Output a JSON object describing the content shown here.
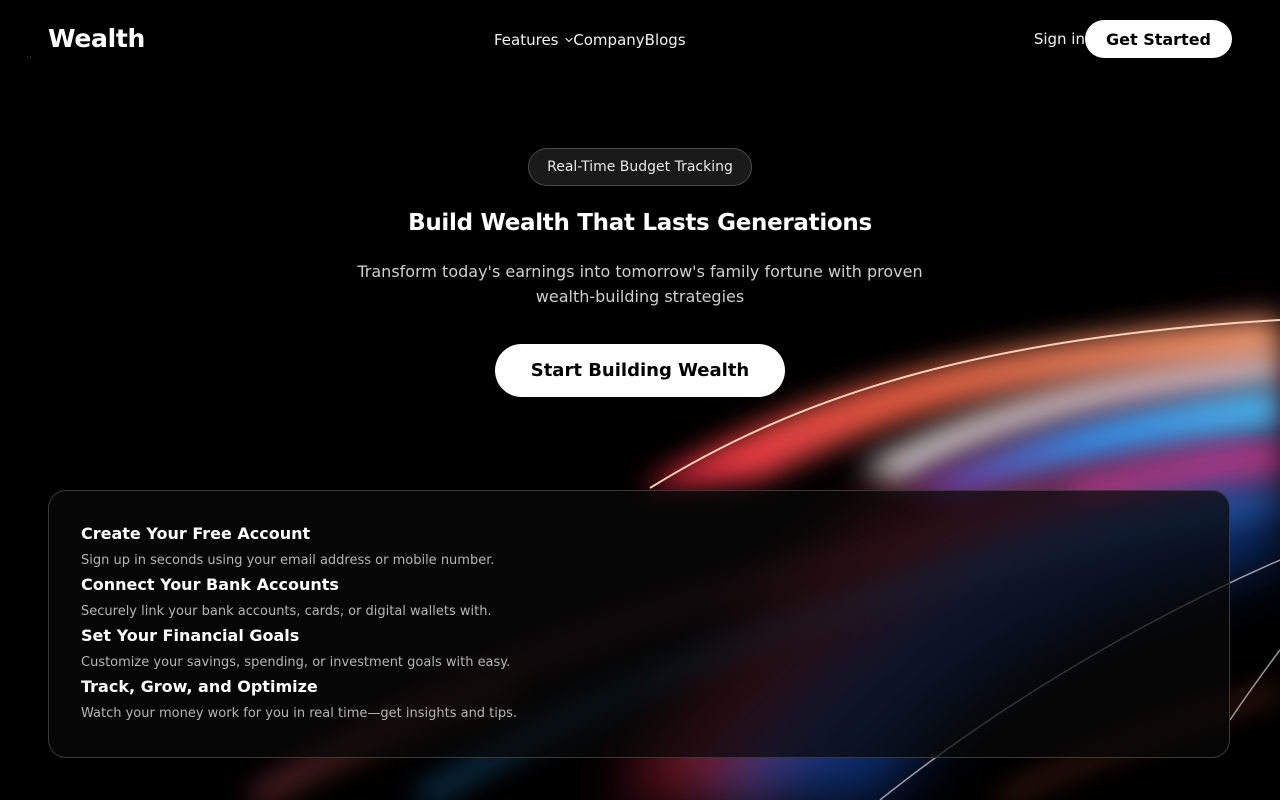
{
  "nav": {
    "logo": "Wealth",
    "links": [
      {
        "label": "Features",
        "has_dropdown": true
      },
      {
        "label": "Company",
        "has_dropdown": false
      },
      {
        "label": "Blogs",
        "has_dropdown": false
      }
    ],
    "signin_label": "Sign in",
    "get_started_label": "Get Started"
  },
  "hero": {
    "badge": "Real-Time Budget Tracking",
    "title": "Build Wealth That Lasts Generations",
    "subtitle": "Transform today's earnings into tomorrow's family fortune with proven wealth-building strategies",
    "cta_label": "Start Building Wealth"
  },
  "steps": [
    {
      "title": "Create Your Free Account",
      "desc": "Sign up in seconds using your email address or mobile number."
    },
    {
      "title": "Connect Your Bank Accounts",
      "desc": "Securely link your bank accounts, cards, or digital wallets with."
    },
    {
      "title": "Set Your Financial Goals",
      "desc": "Customize your savings, spending, or investment goals with easy."
    },
    {
      "title": "Track, Grow, and Optimize",
      "desc": "Watch your money work for you in real time—get insights and tips."
    }
  ],
  "colors": {
    "background": "#000000",
    "button_bg": "#ffffff",
    "button_text": "#000000",
    "accent_red": "#ff3b3b",
    "accent_orange": "#ff8a50",
    "accent_blue": "#2aa8ff",
    "accent_pink": "#e0308a"
  },
  "icons": {
    "features_dropdown": "chevron-down-icon"
  }
}
